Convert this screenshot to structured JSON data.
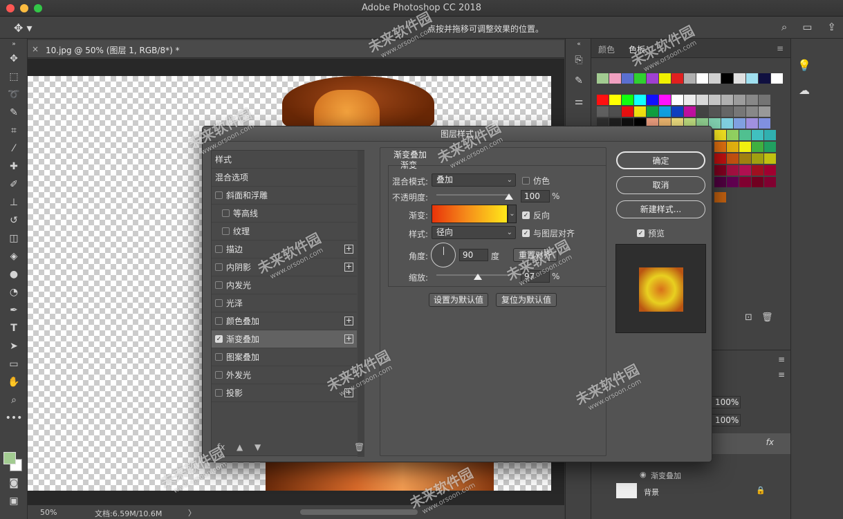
{
  "window": {
    "title": "Adobe Photoshop CC 2018"
  },
  "options_bar": {
    "hint": "点按并拖移可调整效果的位置。"
  },
  "document": {
    "tab_label": "10.jpg @ 50% (图层 1, RGB/8*) *",
    "tab_close": "×"
  },
  "status": {
    "zoom": "50%",
    "doc_size": "文档:6.59M/10.6M",
    "arrow": "〉"
  },
  "panels": {
    "color_tab": "颜色",
    "swatch_tab": "色板",
    "layer_effect_name": "渐变叠加",
    "background_layer": "背景",
    "opacity_value_1": "100%",
    "opacity_value_2": "100%",
    "fx_label": "fx"
  },
  "dialog": {
    "title": "图层样式",
    "styles": [
      {
        "label": "样式",
        "checkbox": false,
        "has_checkbox": false,
        "plus": false,
        "indent": false,
        "selected": false
      },
      {
        "label": "混合选项",
        "checkbox": false,
        "has_checkbox": false,
        "plus": false,
        "indent": false,
        "selected": false
      },
      {
        "label": "斜面和浮雕",
        "checkbox": false,
        "has_checkbox": true,
        "plus": false,
        "indent": false,
        "selected": false
      },
      {
        "label": "等高线",
        "checkbox": false,
        "has_checkbox": true,
        "plus": false,
        "indent": true,
        "selected": false
      },
      {
        "label": "纹理",
        "checkbox": false,
        "has_checkbox": true,
        "plus": false,
        "indent": true,
        "selected": false
      },
      {
        "label": "描边",
        "checkbox": false,
        "has_checkbox": true,
        "plus": true,
        "indent": false,
        "selected": false
      },
      {
        "label": "内阴影",
        "checkbox": false,
        "has_checkbox": true,
        "plus": true,
        "indent": false,
        "selected": false
      },
      {
        "label": "内发光",
        "checkbox": false,
        "has_checkbox": true,
        "plus": false,
        "indent": false,
        "selected": false
      },
      {
        "label": "光泽",
        "checkbox": false,
        "has_checkbox": true,
        "plus": false,
        "indent": false,
        "selected": false
      },
      {
        "label": "颜色叠加",
        "checkbox": false,
        "has_checkbox": true,
        "plus": true,
        "indent": false,
        "selected": false
      },
      {
        "label": "渐变叠加",
        "checkbox": true,
        "has_checkbox": true,
        "plus": true,
        "indent": false,
        "selected": true
      },
      {
        "label": "图案叠加",
        "checkbox": false,
        "has_checkbox": true,
        "plus": false,
        "indent": false,
        "selected": false
      },
      {
        "label": "外发光",
        "checkbox": false,
        "has_checkbox": true,
        "plus": false,
        "indent": false,
        "selected": false
      },
      {
        "label": "投影",
        "checkbox": false,
        "has_checkbox": true,
        "plus": true,
        "indent": false,
        "selected": false
      }
    ],
    "section_title": "渐变叠加",
    "subsection_title": "渐变",
    "blend_mode_label": "混合模式:",
    "blend_mode_value": "叠加",
    "dither_label": "仿色",
    "opacity_label": "不透明度:",
    "opacity_value": "100",
    "percent": "%",
    "gradient_label": "渐变:",
    "reverse_label": "反向",
    "style_label": "样式:",
    "style_value": "径向",
    "align_label": "与图层对齐",
    "angle_label": "角度:",
    "angle_value": "90",
    "degree_unit": "度",
    "reset_align_button": "重置对齐",
    "scale_label": "缩放:",
    "scale_value": "97",
    "make_default_button": "设置为默认值",
    "reset_default_button": "复位为默认值",
    "ok_button": "确定",
    "cancel_button": "取消",
    "new_style_button": "新建样式...",
    "preview_label": "预览",
    "trash": "🗑"
  },
  "watermark": {
    "brand": "未来软件园",
    "url": "www.orsoon.com"
  },
  "colors": {
    "gradient_start": "#e8330a",
    "gradient_end": "#ffe81a",
    "foreground_swatch": "#a2cb91"
  }
}
